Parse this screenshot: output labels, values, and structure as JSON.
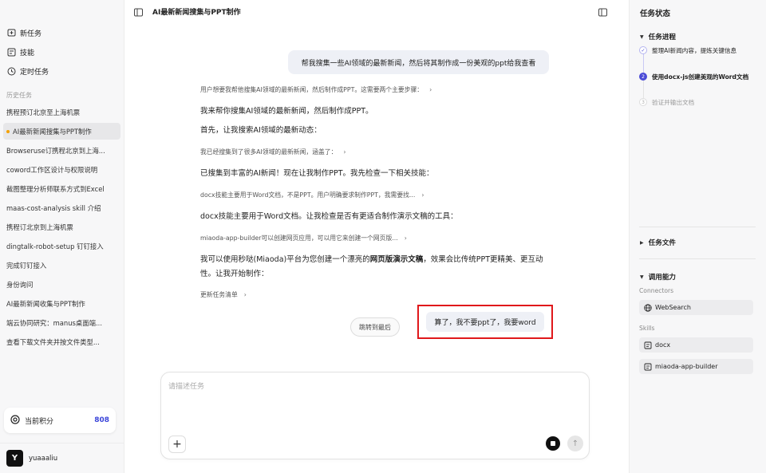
{
  "sidebar": {
    "nav": [
      {
        "label": "新任务",
        "icon": "new-task-icon"
      },
      {
        "label": "技能",
        "icon": "skills-icon"
      },
      {
        "label": "定时任务",
        "icon": "clock-icon"
      }
    ],
    "history_title": "历史任务",
    "history": [
      {
        "label": "携程预订北京至上海机票",
        "active": false
      },
      {
        "label": "AI最新新闻搜集与PPT制作",
        "active": true
      },
      {
        "label": "Browseruse订携程北京到上海...",
        "active": false
      },
      {
        "label": "coword工作区设计与权限说明",
        "active": false
      },
      {
        "label": "截图整理分析师联系方式到Excel",
        "active": false
      },
      {
        "label": "maas-cost-analysis skill 介绍",
        "active": false
      },
      {
        "label": "携程订北京到上海机票",
        "active": false
      },
      {
        "label": "dingtalk-robot-setup 钉钉接入",
        "active": false
      },
      {
        "label": "完成钉钉接入",
        "active": false
      },
      {
        "label": "身份询问",
        "active": false
      },
      {
        "label": "AI最新新闻收集与PPT制作",
        "active": false
      },
      {
        "label": "端云协同研究：manus桌面端...",
        "active": false
      },
      {
        "label": "查看下载文件夹并按文件类型...",
        "active": false
      }
    ],
    "points": {
      "label": "当前积分",
      "value": "808"
    },
    "user": {
      "initial": "Y",
      "name": "yuaaaliu"
    }
  },
  "main": {
    "title": "AI最新新闻搜集与PPT制作",
    "user_message": "帮我搜集一些AI领域的最新新闻，然后将其制作成一份美观的ppt给我查看",
    "step1": "用户想要我帮他搜集AI领域的最新新闻，然后制作成PPT。这需要两个主要步骤：",
    "msg1": "我来帮你搜集AI领域的最新新闻，然后制作成PPT。",
    "msg2": "首先，让我搜索AI领域的最新动态：",
    "step2": "我已经搜集到了很多AI领域的最新新闻，涵盖了：",
    "msg3": "已搜集到丰富的AI新闻！现在让我制作PPT。我先检查一下相关技能：",
    "step3": "docx技能主要用于Word文档，不是PPT。用户明确要求制作PPT，我需要找...",
    "msg4": "docx技能主要用于Word文档。让我检查是否有更适合制作演示文稿的工具：",
    "step4": "miaoda-app-builder可以创建网页应用，可以用它来创建一个网页版...",
    "msg5_a": "我可以使用秒哒(Miaoda)平台为您创建一个漂亮的",
    "msg5_b": "网页版演示文稿",
    "msg5_c": "，效果会比传统PPT更精美、更互动性。让我开始制作：",
    "step5": "更新任务清单",
    "jump_label": "跳转到最后",
    "last_message": "算了，我不要ppt了，我要word",
    "composer_placeholder": "请描述任务"
  },
  "right": {
    "title": "任务状态",
    "progress_title": "任务进程",
    "tasks": [
      {
        "label": "整理AI新闻内容，提炼关键信息",
        "status": "done",
        "marker": "✓"
      },
      {
        "label": "使用docx-js创建美观的Word文档",
        "status": "active",
        "marker": "2"
      },
      {
        "label": "验证并输出文档",
        "status": "pending",
        "marker": "3"
      }
    ],
    "files_title": "任务文件",
    "capability_title": "调用能力",
    "connectors_label": "Connectors",
    "connectors": [
      "WebSearch"
    ],
    "skills_label": "Skills",
    "skills": [
      "docx",
      "miaoda-app-builder"
    ]
  }
}
